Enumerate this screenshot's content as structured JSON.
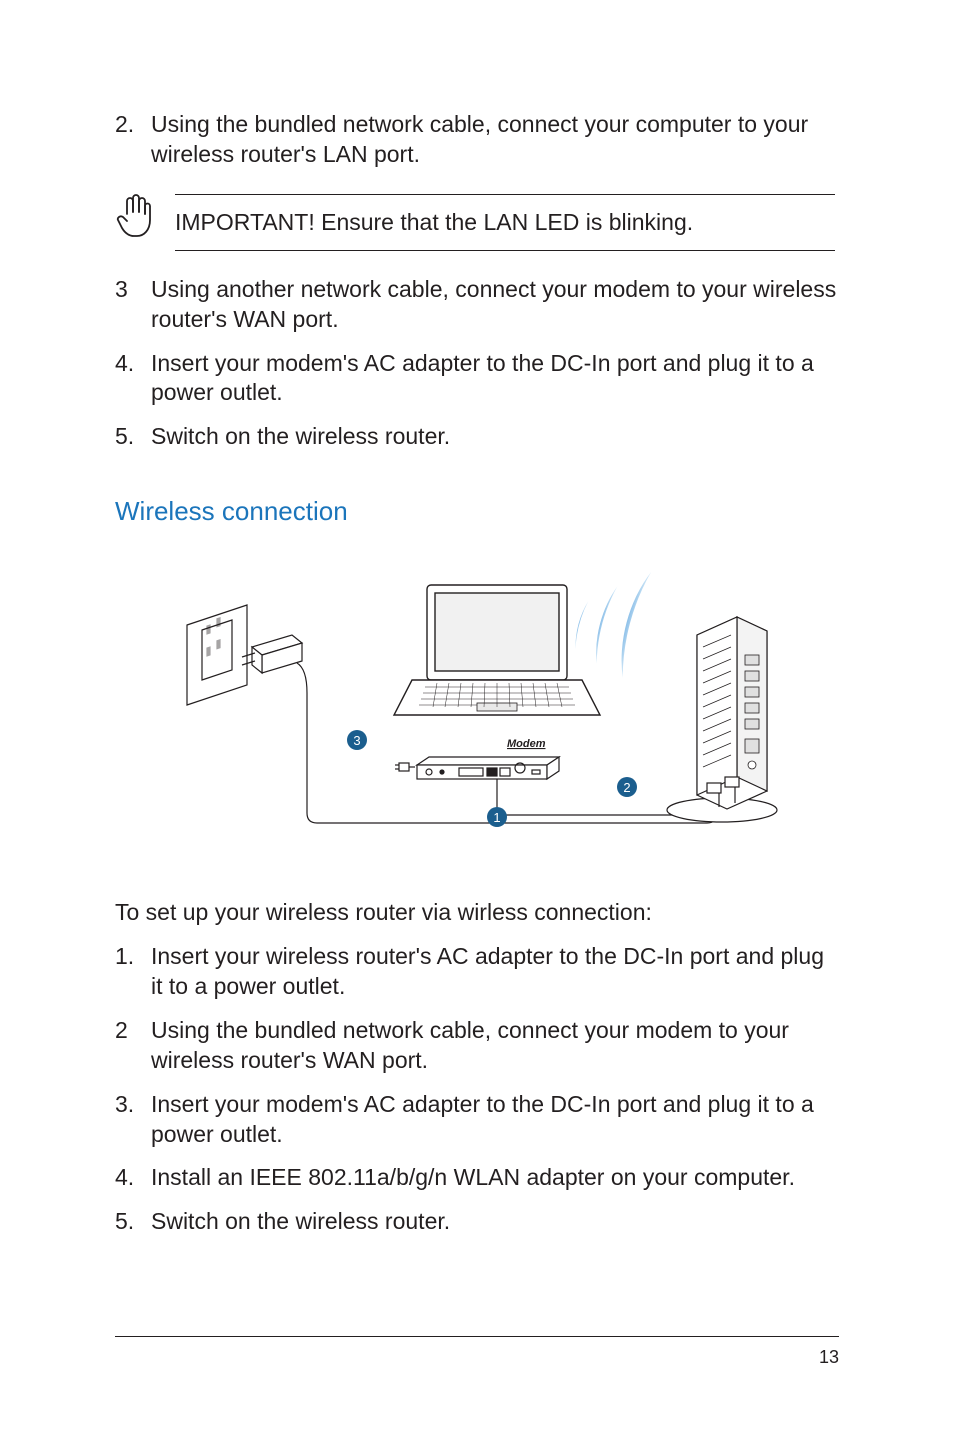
{
  "top_list": [
    {
      "num": "2.",
      "text": "Using the bundled network cable, connect your computer to your wireless router's LAN port."
    }
  ],
  "callout": {
    "text": "IMPORTANT!  Ensure that the LAN LED is blinking."
  },
  "mid_list": [
    {
      "num": "3",
      "text": "Using another network cable, connect your modem to your wireless router's WAN port."
    },
    {
      "num": "4.",
      "text": "Insert your modem's AC adapter to the DC-In port and plug it to a power outlet."
    },
    {
      "num": "5.",
      "text": "Switch on the wireless router."
    }
  ],
  "section_heading": "Wireless connection",
  "diagram": {
    "label_modem": "Modem",
    "callouts": {
      "c1": "1",
      "c2": "2",
      "c3": "3"
    }
  },
  "intro": "To set up your wireless router via wirless connection:",
  "bottom_list": [
    {
      "num": "1.",
      "text": "Insert your wireless router's AC adapter to the DC-In port and plug it to a power outlet."
    },
    {
      "num": "2",
      "text": "Using the bundled network cable, connect your modem to your wireless router's WAN port."
    },
    {
      "num": "3.",
      "text": "Insert your modem's AC adapter to the DC-In port and plug it to a power outlet."
    },
    {
      "num": "4.",
      "text": "Install an IEEE 802.11a/b/g/n WLAN adapter on your computer."
    },
    {
      "num": "5.",
      "text": "Switch on the wireless router."
    }
  ],
  "page_number": "13"
}
